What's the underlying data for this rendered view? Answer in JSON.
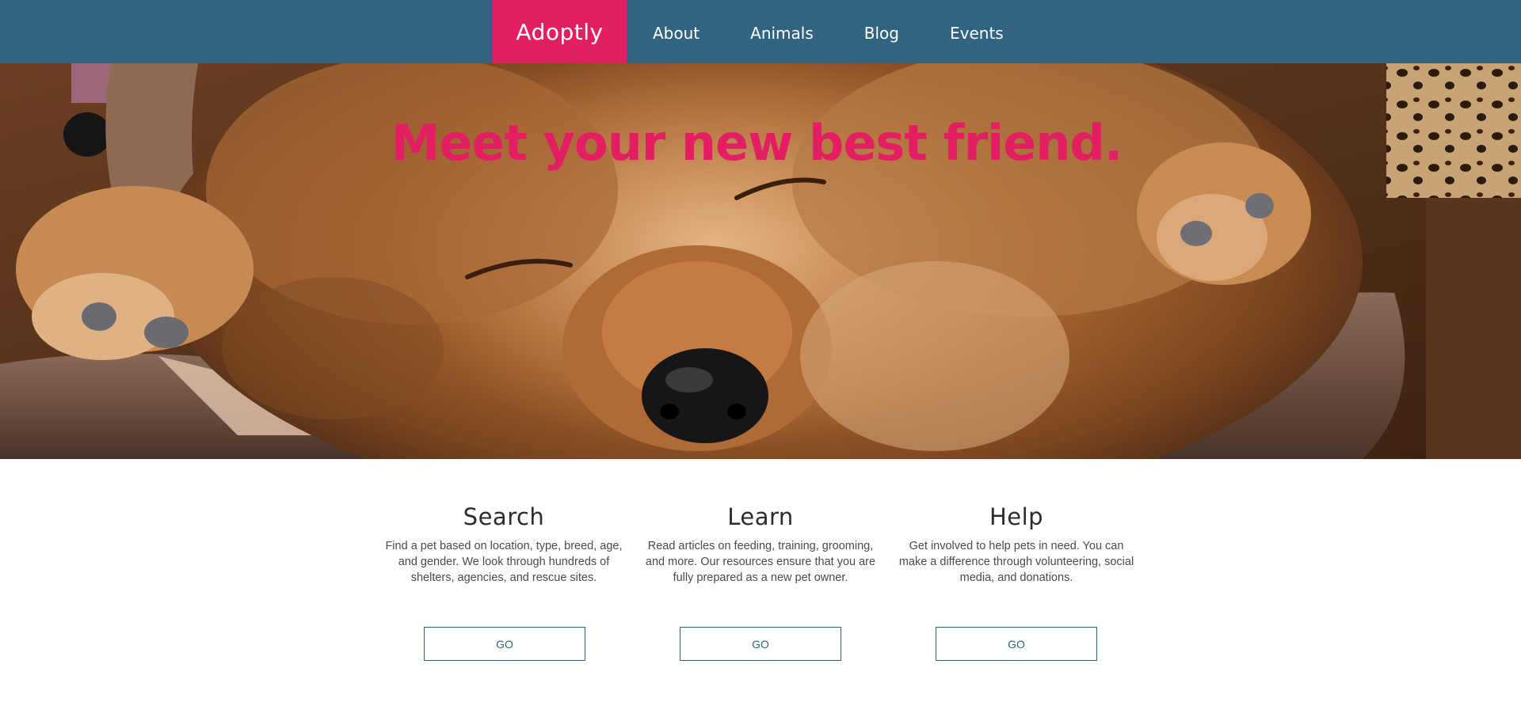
{
  "nav": {
    "brand": "Adoptly",
    "links": [
      "About",
      "Animals",
      "Blog",
      "Events"
    ]
  },
  "hero": {
    "title": "Meet your new best friend."
  },
  "features": [
    {
      "title": "Search",
      "text": "Find a pet based on location, type, breed, age, and gender. We look through hundreds of shelters, agencies, and rescue sites.",
      "button": "GO"
    },
    {
      "title": "Learn",
      "text": "Read articles on feeding, training, grooming, and more. Our resources ensure that you are fully prepared as a new pet owner.",
      "button": "GO"
    },
    {
      "title": "Help",
      "text": "Get involved to help pets in need. You can make a difference through volunteering, social media, and donations.",
      "button": "GO"
    }
  ],
  "colors": {
    "nav_background": "#306481",
    "brand_accent": "#e31e63",
    "button_border": "#306481"
  }
}
